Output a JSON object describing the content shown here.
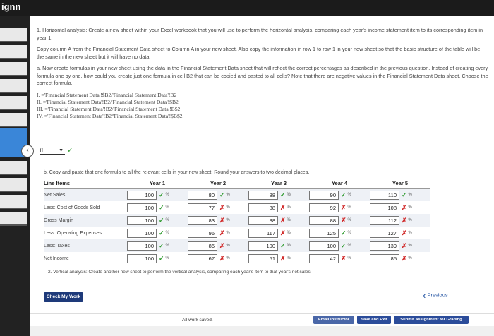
{
  "window": {
    "title": "ignn"
  },
  "question": {
    "intro": "1. Horizontal analysis: Create a new sheet within your Excel workbook that you will use to perform the horizontal analysis, comparing each year's income statement item to its corresponding item in year 1.",
    "copy_instructions": "Copy column A from the Financial Statement Data sheet to Column A in your new sheet. Also copy the information in row 1 to row 1 in your new sheet so that the basic structure of the table will be the same in the new sheet but it will have no data.",
    "part_a": "a. Now create formulas in your new sheet using the data in the Financial Statement Data sheet that will reflect the correct percentages as described in the previous question. Instead of creating every formula one by one, how could you create just one formula in cell B2 that can be copied and pasted to all cells? Note that there are negative values in the Financial Statement Data sheet. Choose the correct formula.",
    "options": [
      "I. ='Financial Statement Data'!$B2/'Financial Statement Data'!B2",
      "II. ='Financial Statement Data'!B2/'Financial Statement Data'!$B2",
      "III. ='Financial Statement Data'!B2/'Financial Statement Data'!B$2",
      "IV. ='Financial Statement Data'!B2/'Financial Statement Data'!$B$2"
    ],
    "selected_answer": "II",
    "part_b": "b. Copy and paste that one formula to all the relevant cells in your new sheet. Round your answers to two decimal places.",
    "part_2": "2. Vertical analysis: Create another new sheet to perform the vertical analysis, comparing each year's item to that year's net sales:"
  },
  "table": {
    "header_label": "Line Items",
    "years": [
      "Year 1",
      "Year 2",
      "Year 3",
      "Year 4",
      "Year 5"
    ],
    "pct_symbol": "%",
    "check_mark": "✓",
    "cross_mark": "✗",
    "rows": [
      {
        "label": "Net Sales",
        "values": [
          "100",
          "80",
          "88",
          "90",
          "110"
        ],
        "correct": [
          true,
          true,
          true,
          true,
          true
        ]
      },
      {
        "label": "Less: Cost of Goods Sold",
        "values": [
          "100",
          "77",
          "88",
          "92",
          "108"
        ],
        "correct": [
          true,
          false,
          false,
          false,
          false
        ]
      },
      {
        "label": "Gross Margin",
        "values": [
          "100",
          "83",
          "88",
          "88",
          "112"
        ],
        "correct": [
          true,
          false,
          false,
          false,
          false
        ]
      },
      {
        "label": "Less: Operating Expenses",
        "values": [
          "100",
          "96",
          "117",
          "125",
          "127"
        ],
        "correct": [
          true,
          false,
          false,
          true,
          false
        ]
      },
      {
        "label": "Less: Taxes",
        "values": [
          "100",
          "86",
          "100",
          "100",
          "139"
        ],
        "correct": [
          true,
          false,
          true,
          true,
          false
        ]
      },
      {
        "label": "Net Income",
        "values": [
          "100",
          "67",
          "51",
          "42",
          "85"
        ],
        "correct": [
          true,
          false,
          false,
          false,
          false
        ]
      }
    ]
  },
  "buttons": {
    "check_my_work": "Check My Work",
    "previous": "Previous",
    "email_instructor": "Email Instructor",
    "save_and_exit": "Save and Exit",
    "submit": "Submit Assignment for Grading"
  },
  "status": {
    "saved": "All work saved."
  }
}
